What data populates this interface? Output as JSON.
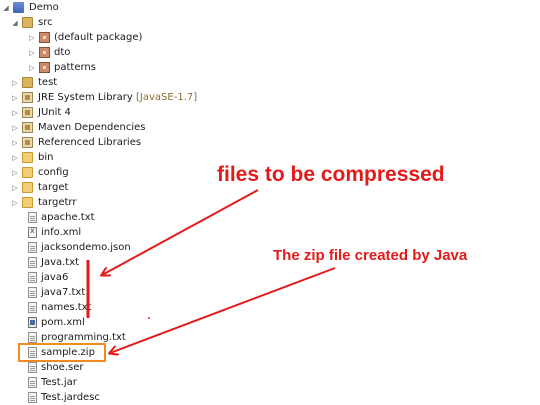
{
  "tree": {
    "project": "Demo",
    "src": "src",
    "packages": [
      "(default package)",
      "dto",
      "patterns"
    ],
    "test": "test",
    "jre_label": "JRE System Library",
    "jre_decoration": "[JavaSE-1.7]",
    "junit": "JUnit 4",
    "maven": "Maven Dependencies",
    "referenced": "Referenced Libraries",
    "folders": [
      "bin",
      "config",
      "target",
      "targetrr"
    ],
    "files": [
      "apache.txt",
      "info.xml",
      "jacksondemo.json",
      "Java.txt",
      "java6",
      "java7.txt",
      "names.txt",
      "pom.xml",
      "programming.txt",
      "sample.zip",
      "shoe.ser",
      "Test.jar",
      "Test.jardesc"
    ]
  },
  "annotations": {
    "compress_label": "files to be compressed",
    "zip_label": "The zip file created by Java",
    "color": "#e41a1a",
    "highlight_color": "#f28a22"
  }
}
